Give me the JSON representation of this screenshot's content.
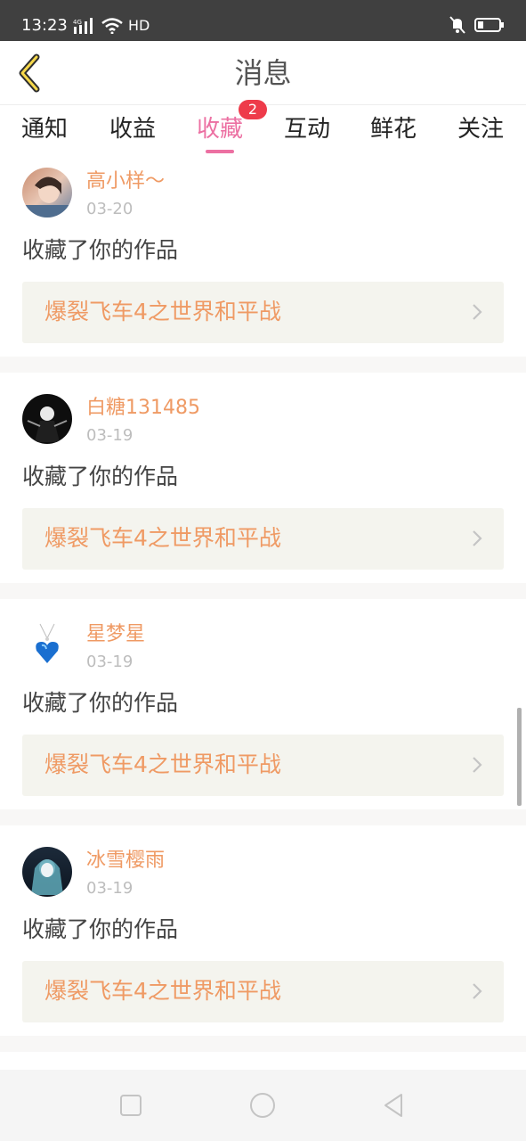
{
  "status_bar": {
    "time": "13:23",
    "network": "4G",
    "hd": "HD",
    "icons": [
      "signal-icon",
      "wifi-icon",
      "mute-icon",
      "battery-icon"
    ]
  },
  "header": {
    "title": "消息",
    "back_icon": "chevron-left-icon"
  },
  "tabs": {
    "items": [
      {
        "label": "通知"
      },
      {
        "label": "收益"
      },
      {
        "label": "收藏",
        "active": true,
        "badge": "2"
      },
      {
        "label": "互动"
      },
      {
        "label": "鲜花"
      },
      {
        "label": "关注"
      }
    ],
    "active_color": "#ec70a2",
    "badge_color": "#ee3b4a"
  },
  "feed": {
    "items": [
      {
        "username": "高小样～",
        "date": "03-20",
        "action": "收藏了你的作品",
        "work_title": "爆裂飞车4之世界和平战"
      },
      {
        "username": "白糖131485",
        "date": "03-19",
        "action": "收藏了你的作品",
        "work_title": "爆裂飞车4之世界和平战"
      },
      {
        "username": "星梦星",
        "date": "03-19",
        "action": "收藏了你的作品",
        "work_title": "爆裂飞车4之世界和平战"
      },
      {
        "username": "冰雪樱雨",
        "date": "03-19",
        "action": "收藏了你的作品",
        "work_title": "爆裂飞车4之世界和平战"
      }
    ],
    "accent_color": "#ef9a64"
  },
  "nav_bar": {
    "buttons": [
      "recent-apps-icon",
      "home-icon",
      "back-icon"
    ]
  }
}
